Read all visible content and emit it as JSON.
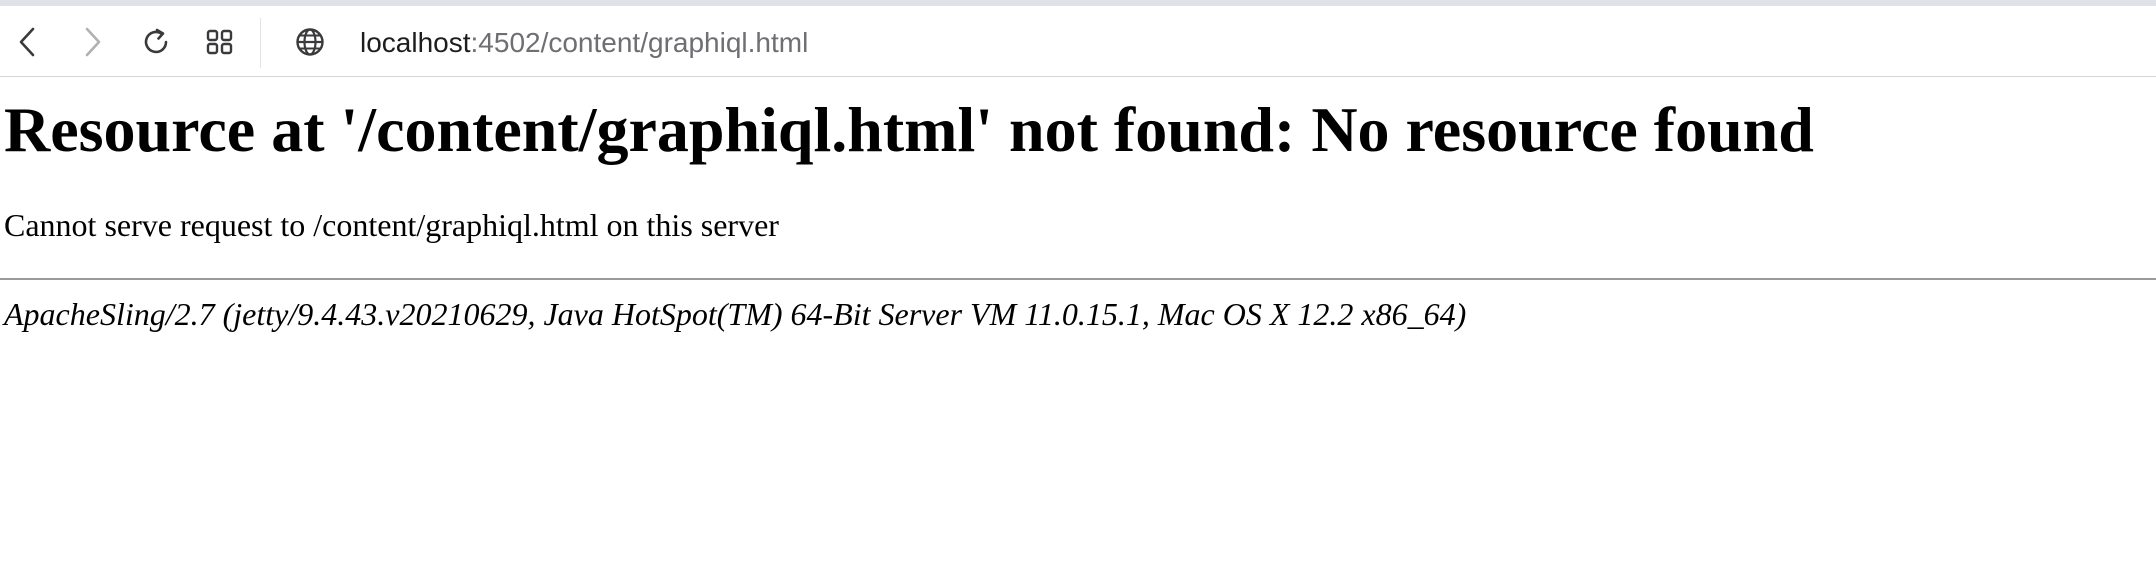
{
  "browser": {
    "url": {
      "host": "localhost",
      "rest": ":4502/content/graphiql.html"
    },
    "icons": {
      "back": "chevron-left-icon",
      "forward": "chevron-right-icon",
      "reload": "reload-icon",
      "tabs": "tab-overview-icon",
      "site": "globe-icon"
    }
  },
  "page": {
    "title": "Resource at '/content/graphiql.html' not found: No resource found",
    "message": "Cannot serve request to /content/graphiql.html on this server",
    "signature": "ApacheSling/2.7 (jetty/9.4.43.v20210629, Java HotSpot(TM) 64-Bit Server VM 11.0.15.1, Mac OS X 12.2 x86_64)"
  },
  "colors": {
    "toolbar_bg": "#ffffff",
    "top_strip": "#dfe3e8",
    "url_host": "#1d1d1f",
    "url_path": "#6e6e73",
    "icon_active": "#3a3a3c",
    "icon_disabled": "#b0b0b5"
  }
}
